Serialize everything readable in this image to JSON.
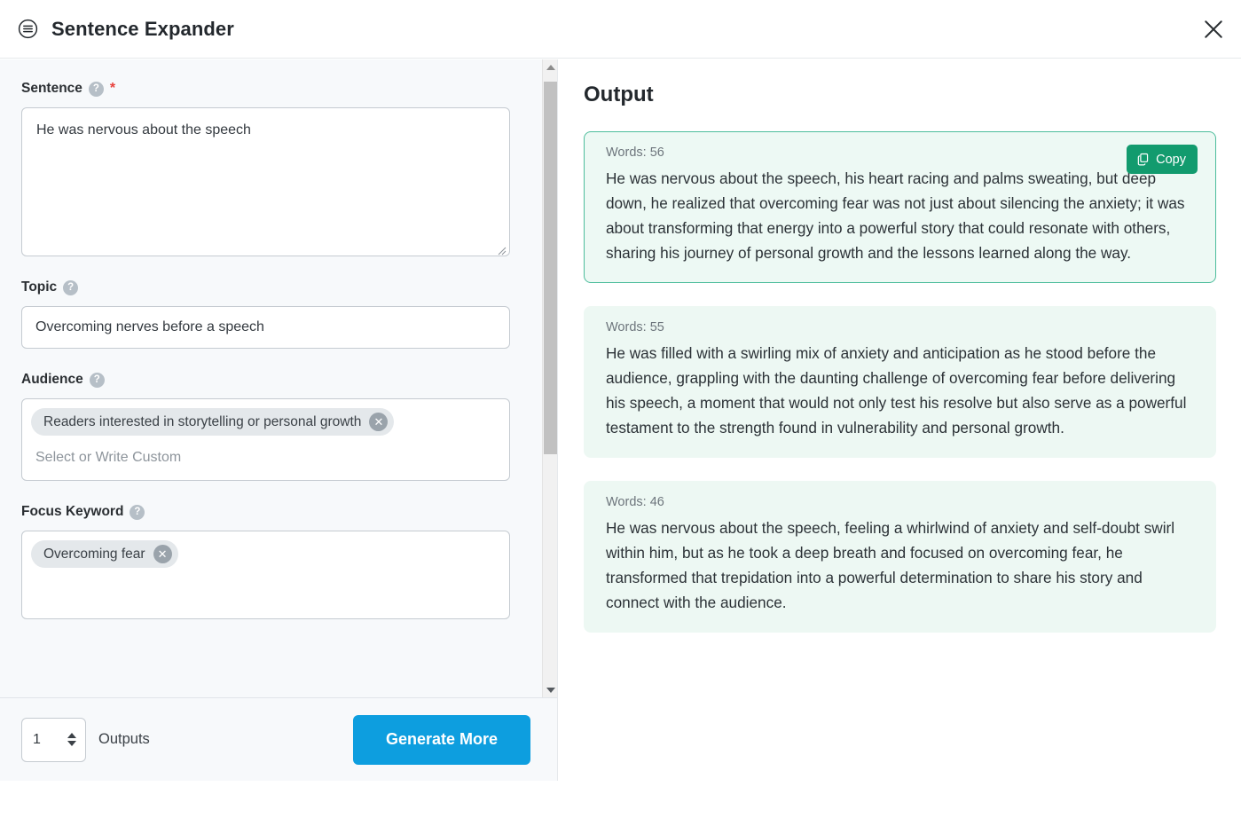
{
  "header": {
    "menu_icon": "list-circle-icon",
    "title": "Sentence Expander",
    "close_icon": "close-icon"
  },
  "form": {
    "fields": [
      {
        "id": "sentence",
        "label": "Sentence",
        "help_icon": "question-mark-icon",
        "required_marker": "*",
        "type": "textarea",
        "value": "He was nervous about the speech"
      },
      {
        "id": "topic",
        "label": "Topic",
        "help_icon": "question-mark-icon",
        "type": "text",
        "value": "Overcoming nerves before a speech"
      },
      {
        "id": "audience",
        "label": "Audience",
        "help_icon": "question-mark-icon",
        "type": "tags",
        "tags": [
          "Readers interested in storytelling or personal growth"
        ],
        "placeholder": "Select or Write Custom"
      },
      {
        "id": "focus_keyword",
        "label": "Focus Keyword",
        "help_icon": "question-mark-icon",
        "type": "tags",
        "tags": [
          "Overcoming fear"
        ],
        "placeholder": ""
      }
    ],
    "scrollbar": {
      "up_icon": "chevron-up-icon",
      "down_icon": "chevron-down-icon"
    }
  },
  "footer": {
    "outputs_count": "1",
    "outputs_label": "Outputs",
    "generate_label": "Generate More",
    "generate_color": "#0d9edf"
  },
  "output": {
    "title": "Output",
    "copy_label": "Copy",
    "copy_icon": "copy-icon",
    "copy_color": "#129b6e",
    "highlight_border": "#4dbd9c",
    "card_bg": "#edf8f3",
    "cards": [
      {
        "words_label": "Words: 56",
        "text": "He was nervous about the speech, his heart racing and palms sweating, but deep down, he realized that overcoming fear was not just about silencing the anxiety; it was about transforming that energy into a powerful story that could resonate with others, sharing his journey of personal growth and the lessons learned along the way.",
        "has_copy": true,
        "highlighted": true
      },
      {
        "words_label": "Words: 55",
        "text": "He was filled with a swirling mix of anxiety and anticipation as he stood before the audience, grappling with the daunting challenge of overcoming fear before delivering his speech, a moment that would not only test his resolve but also serve as a powerful testament to the strength found in vulnerability and personal growth.",
        "has_copy": false,
        "highlighted": false
      },
      {
        "words_label": "Words: 46",
        "text": "He was nervous about the speech, feeling a whirlwind of anxiety and self-doubt swirl within him, but as he took a deep breath and focused on overcoming fear, he transformed that trepidation into a powerful determination to share his story and connect with the audience.",
        "has_copy": false,
        "highlighted": false
      }
    ]
  }
}
